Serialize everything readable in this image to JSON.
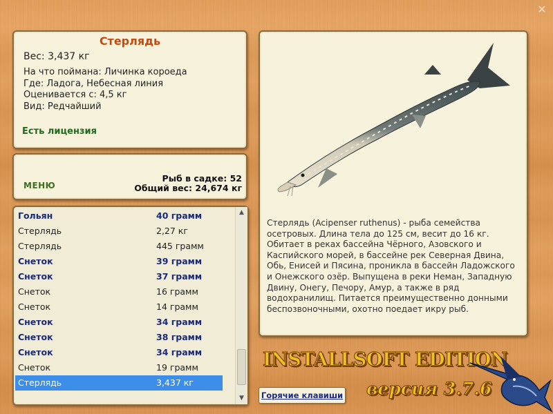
{
  "caught_fish": {
    "name": "Стерлядь",
    "weight_label": "Вес: 3,437 кг",
    "details": [
      "На что поймана: Личинка короеда",
      "Где: Ладога, Небесная линия",
      "Оценивается с: 4,5 кг",
      "Вид: Редчайший"
    ],
    "license": "Есть лицензия"
  },
  "menu_label": "МЕНЮ",
  "stats": {
    "fish_count": "Рыб в садке: 52",
    "total_weight": "Общий вес: 24,674 кг"
  },
  "catch_list": [
    {
      "name": "Гольян",
      "weight": "40 грамм",
      "bold": true
    },
    {
      "name": "Стерлядь",
      "weight": "2,27 кг",
      "bold": false
    },
    {
      "name": "Стерлядь",
      "weight": "445 грамм",
      "bold": false
    },
    {
      "name": "Снеток",
      "weight": "39 грамм",
      "bold": true
    },
    {
      "name": "Снеток",
      "weight": "37 грамм",
      "bold": true
    },
    {
      "name": "Снеток",
      "weight": "16 грамм",
      "bold": false
    },
    {
      "name": "Снеток",
      "weight": "14 грамм",
      "bold": false
    },
    {
      "name": "Снеток",
      "weight": "34 грамм",
      "bold": true
    },
    {
      "name": "Снеток",
      "weight": "38 грамм",
      "bold": true
    },
    {
      "name": "Снеток",
      "weight": "34 грамм",
      "bold": true
    },
    {
      "name": "Снеток",
      "weight": "19 грамм",
      "bold": false
    },
    {
      "name": "Стерлядь",
      "weight": "3,437 кг",
      "bold": false,
      "selected": true
    }
  ],
  "description": "Стерлядь (Acipenser ruthenus) - рыба семейства осетровых. Длина тела до 125 см, весит до 16 кг. Обитает в реках бассейна Чёрного, Азовского и Каспийского морей, в бассейне рек Северная Двина, Обь, Енисей и Пясина, проникла в бассейн Ладожского и Онежского озёр. Выпущена в реки Неман, Западную Двину, Онегу, Печору, Амур, а также в ряд водохранилищ. Питается преимущественно донными беспозвоночными, охотно поедает икру рыб.",
  "hotkeys_label": "Горячие клавиши",
  "brand": {
    "edition": "INSTALLSOFT EDITION",
    "version": "версия 3.7.6"
  },
  "close_glyph": "✕",
  "colors": {
    "title": "#c44a10",
    "license": "#1e6b1e",
    "selected_row": "#3d8ee8",
    "bold_row": "#1a2a7a"
  }
}
